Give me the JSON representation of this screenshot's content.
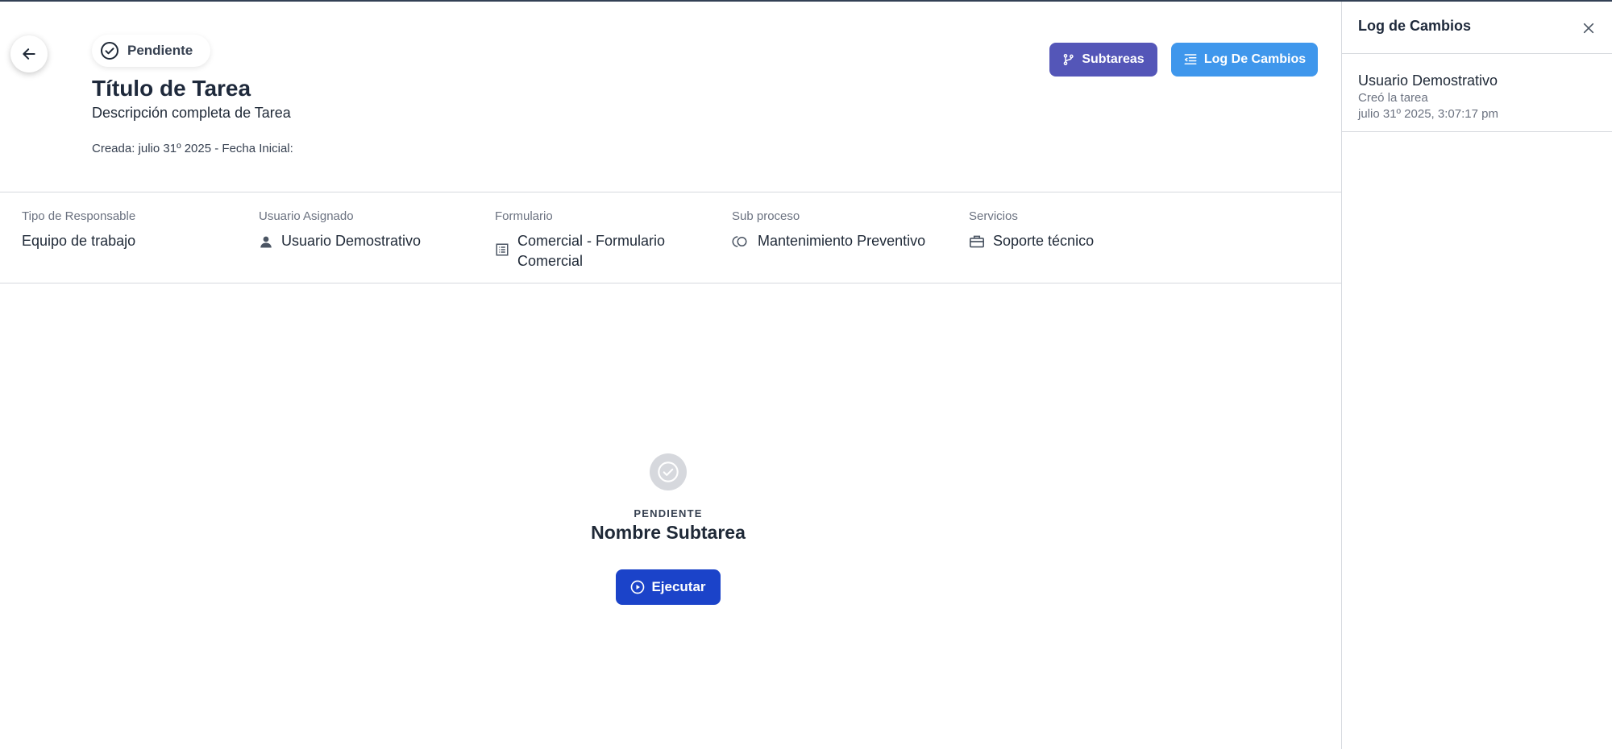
{
  "colors": {
    "subtareas_button": "#5456b8",
    "log_button": "#3f97ec",
    "execute_button": "#1b43c9",
    "empty_icon_bg": "#d6d8dd"
  },
  "task": {
    "status": "Pendiente",
    "title": "Título de Tarea",
    "description": "Descripción completa de Tarea",
    "dates": "Creada: julio 31º 2025 - Fecha Inicial:"
  },
  "actions": {
    "subtareas_label": "Subtareas",
    "log_label": "Log De Cambios"
  },
  "info": {
    "tipo_responsable_label": "Tipo de Responsable",
    "tipo_responsable_value": "Equipo de trabajo",
    "usuario_asignado_label": "Usuario Asignado",
    "usuario_asignado_value": "Usuario Demostrativo",
    "formulario_label": "Formulario",
    "formulario_value": "Comercial - Formulario Comercial",
    "subproceso_label": "Sub proceso",
    "subproceso_value": "Mantenimiento Preventivo",
    "servicios_label": "Servicios",
    "servicios_value": "Soporte técnico"
  },
  "subtask": {
    "status": "PENDIENTE",
    "name": "Nombre Subtarea",
    "execute_label": "Ejecutar"
  },
  "log": {
    "title": "Log de Cambios",
    "entries": [
      {
        "user": "Usuario Demostrativo",
        "action": "Creó la tarea",
        "time": "julio 31º 2025, 3:07:17 pm"
      }
    ]
  },
  "icons": {
    "back": "arrow-left-icon",
    "status": "check-circle-icon",
    "subtareas": "branch-icon",
    "log": "list-indent-icon",
    "user": "person-icon",
    "form": "form-list-icon",
    "subprocess": "subprocess-icon",
    "services": "briefcase-icon",
    "execute": "play-circle-icon",
    "close": "close-icon"
  }
}
